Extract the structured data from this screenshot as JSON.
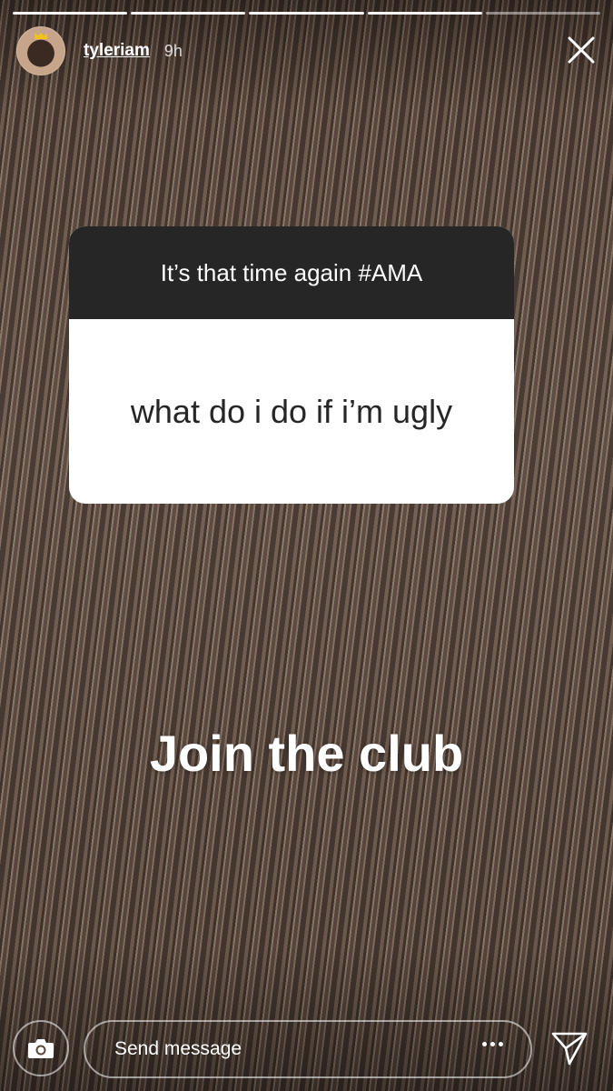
{
  "story": {
    "progress_segments": 5,
    "progress_completed": 4
  },
  "header": {
    "username": "tyleriam",
    "time_ago": "9h",
    "avatar_icon": "user-avatar",
    "close_icon": "close-icon"
  },
  "question_sticker": {
    "prompt": "It’s that time again #AMA",
    "question": "what do i do if i’m ugly"
  },
  "caption": "Join the club",
  "footer": {
    "camera_icon": "camera-icon",
    "message_placeholder": "Send message",
    "more_icon": "more-dots-icon",
    "send_icon": "send-icon"
  },
  "colors": {
    "sticker_header": "#262626",
    "sticker_body": "#ffffff",
    "text_dark": "#262626",
    "crown": "#f2c21b"
  }
}
